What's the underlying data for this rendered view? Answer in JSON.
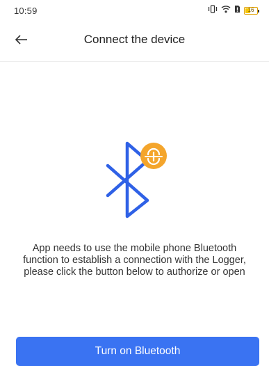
{
  "status_bar": {
    "time": "10:59",
    "battery_level": "16",
    "icons": [
      "vibrate-icon",
      "wifi-icon",
      "sim-alert-icon",
      "battery-icon"
    ]
  },
  "header": {
    "title": "Connect the device",
    "back_icon": "arrow-left-icon"
  },
  "illustration": {
    "icons": [
      "bluetooth-icon",
      "link-badge-icon"
    ]
  },
  "message": {
    "text": "App needs to use the mobile phone Bluetooth function to establish a connection with the Logger, please click the button below to authorize or open"
  },
  "actions": {
    "turn_on_bluetooth_label": "Turn on Bluetooth"
  },
  "colors": {
    "accent": "#3a73f2",
    "bluetooth_blue": "#2f61e6",
    "badge_orange": "#f4a52c",
    "text": "#333333"
  }
}
